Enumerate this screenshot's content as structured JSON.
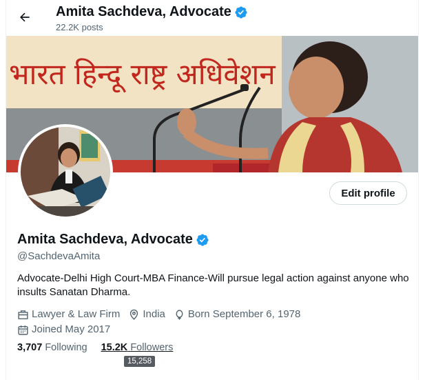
{
  "header": {
    "name": "Amita Sachdeva, Advocate",
    "posts": "22.2K posts"
  },
  "banner": {
    "hindi_text": "भारत हिन्दू राष्ट्र अधिवेशन"
  },
  "profile": {
    "name": "Amita Sachdeva, Advocate",
    "handle": "@SachdevaAmita",
    "bio": "Advocate-Delhi High Court-MBA Finance-Will pursue legal action against anyone who insults Sanatan Dharma.",
    "edit_label": "Edit profile"
  },
  "meta": {
    "category": "Lawyer & Law Firm",
    "location": "India",
    "born": "Born September 6, 1978",
    "joined": "Joined May 2017"
  },
  "stats": {
    "following_count": "3,707",
    "following_label": "Following",
    "followers_count": "15.2K",
    "followers_label": "Followers",
    "followers_tooltip": "15,258"
  },
  "colors": {
    "verified": "#1d9bf0",
    "muted": "#536471",
    "text": "#0f1419"
  },
  "icons": {
    "back": "arrow-left-icon",
    "verified": "verified-badge-icon",
    "category": "briefcase-icon",
    "location": "location-pin-icon",
    "born": "balloon-icon",
    "joined": "calendar-icon"
  }
}
